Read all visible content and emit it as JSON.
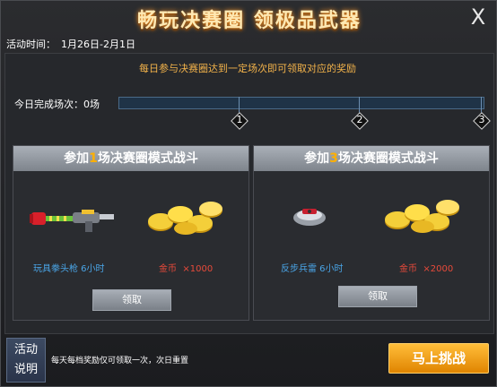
{
  "header": {
    "title": "畅玩决赛圈 领极品武器",
    "close_glyph": "X"
  },
  "activity_time": {
    "label": "活动时间：",
    "value": "1月26日-2月1日"
  },
  "notice": "每日参与决赛圈达到一定场次即可领取对应的奖励",
  "progress": {
    "label": "今日完成场次：0场",
    "completed": 0,
    "milestones": [
      "1",
      "2",
      "3"
    ]
  },
  "cards": [
    {
      "title_prefix": "参加",
      "title_count": "1",
      "title_suffix": "场决赛圈模式战斗",
      "item_name": "玩具拳头枪 6小时",
      "coin_label": "金币",
      "coin_amount": "×1000",
      "claim_label": "领取"
    },
    {
      "title_prefix": "参加",
      "title_count": "3",
      "title_suffix": "场决赛圈模式战斗",
      "item_name": "反步兵雷 6小时",
      "coin_label": "金币",
      "coin_amount": "×2000",
      "claim_label": "领取"
    }
  ],
  "footer": {
    "help_line1": "活动",
    "help_line2": "说明",
    "help_text": "每天每档奖励仅可领取一次，次日重置",
    "challenge_label": "马上挑战"
  },
  "colors": {
    "highlight": "#ffb000",
    "item_text": "#4aa6e8",
    "coin_text": "#e84a3a",
    "notice": "#f2b24a"
  }
}
